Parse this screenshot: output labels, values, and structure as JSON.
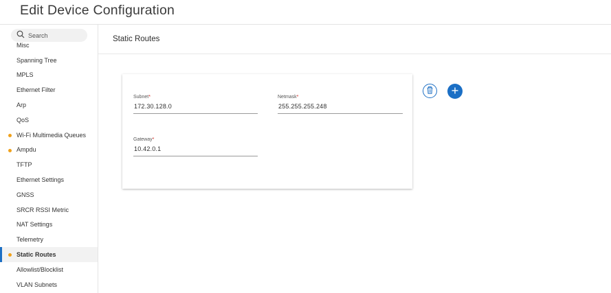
{
  "page": {
    "title": "Edit Device Configuration"
  },
  "search": {
    "placeholder": "Search",
    "icon": "search-icon"
  },
  "sidebar": {
    "items": [
      {
        "label": "Misc",
        "dot": false,
        "active": false
      },
      {
        "label": "Spanning Tree",
        "dot": false,
        "active": false
      },
      {
        "label": "MPLS",
        "dot": false,
        "active": false
      },
      {
        "label": "Ethernet Filter",
        "dot": false,
        "active": false
      },
      {
        "label": "Arp",
        "dot": false,
        "active": false
      },
      {
        "label": "QoS",
        "dot": false,
        "active": false
      },
      {
        "label": "Wi-Fi Multimedia Queues",
        "dot": true,
        "active": false
      },
      {
        "label": "Ampdu",
        "dot": true,
        "active": false
      },
      {
        "label": "TFTP",
        "dot": false,
        "active": false
      },
      {
        "label": "Ethernet Settings",
        "dot": false,
        "active": false
      },
      {
        "label": "GNSS",
        "dot": false,
        "active": false
      },
      {
        "label": "SRCR RSSI Metric",
        "dot": false,
        "active": false
      },
      {
        "label": "NAT Settings",
        "dot": false,
        "active": false
      },
      {
        "label": "Telemetry",
        "dot": false,
        "active": false
      },
      {
        "label": "Static Routes",
        "dot": true,
        "active": true
      },
      {
        "label": "Allowlist/Blocklist",
        "dot": false,
        "active": false
      },
      {
        "label": "VLAN Subnets",
        "dot": false,
        "active": false
      }
    ]
  },
  "main": {
    "section_title": "Static Routes",
    "route": {
      "subnet": {
        "label": "Subnet",
        "required": "*",
        "value": "172.30.128.0"
      },
      "netmask": {
        "label": "Netmask",
        "required": "*",
        "value": "255.255.255.248"
      },
      "gateway": {
        "label": "Gateway",
        "required": "*",
        "value": "10.42.0.1"
      }
    },
    "actions": {
      "delete_icon": "trash-icon",
      "add_icon": "plus-icon"
    }
  },
  "colors": {
    "accent": "#1b6fc5",
    "modified_dot": "#f0a11b",
    "required": "#d3251d"
  }
}
